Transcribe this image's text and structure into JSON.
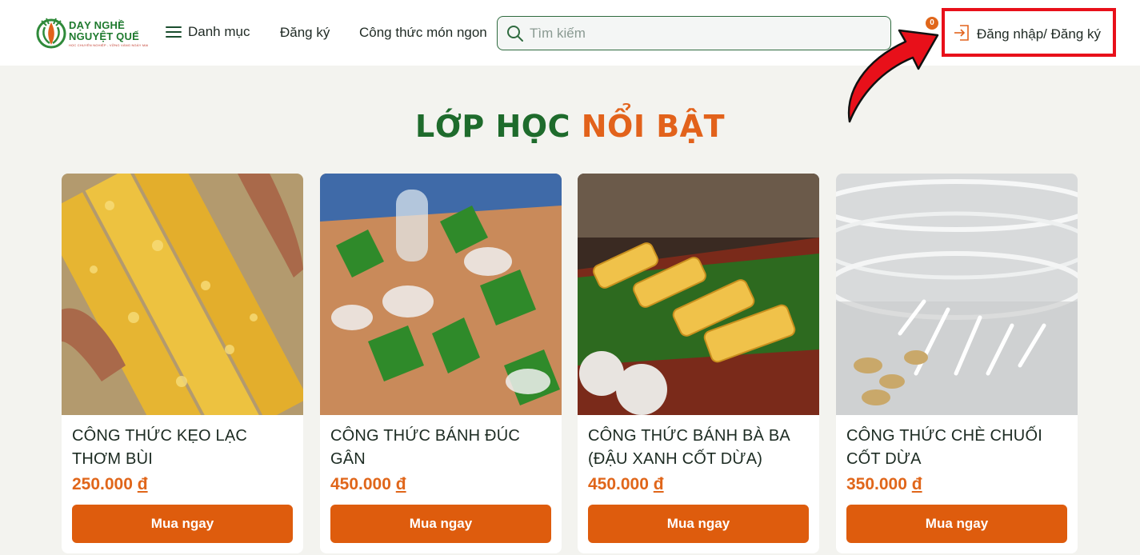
{
  "brand": {
    "line1": "DẠY NGHỀ",
    "line2": "NGUYỆT QUẾ",
    "tagline": "HỌC CHUYÊN NGHIỆP - VỮNG VÀNG NGÀY MAI"
  },
  "nav": {
    "menu_label": "Danh mục",
    "register_label": "Đăng ký",
    "recipes_label": "Công thức món ngon"
  },
  "search": {
    "placeholder": "Tìm kiếm"
  },
  "cart": {
    "count": "0"
  },
  "login": {
    "label": "Đăng nhập/ Đăng ký"
  },
  "section": {
    "title_part1": "LỚP HỌC ",
    "title_part2": "NỔI BẬT"
  },
  "products": [
    {
      "title": "CÔNG THỨC KẸO LẠC THƠM BÙI",
      "price": "250.000",
      "currency": "đ",
      "button": "Mua ngay"
    },
    {
      "title": "CÔNG THỨC BÁNH ĐÚC GÂN",
      "price": "450.000",
      "currency": "đ",
      "button": "Mua ngay"
    },
    {
      "title": "CÔNG THỨC BÁNH BÀ BA (ĐẬU XANH CỐT DỪA)",
      "price": "450.000",
      "currency": "đ",
      "button": "Mua ngay"
    },
    {
      "title": "CÔNG THỨC CHÈ CHUỐI CỐT DỪA",
      "price": "350.000",
      "currency": "đ",
      "button": "Mua ngay"
    }
  ],
  "colors": {
    "brand_green": "#1e6b2c",
    "accent_orange": "#de5c0d",
    "highlight_red": "#e8101a",
    "page_bg": "#f3f3ef"
  }
}
